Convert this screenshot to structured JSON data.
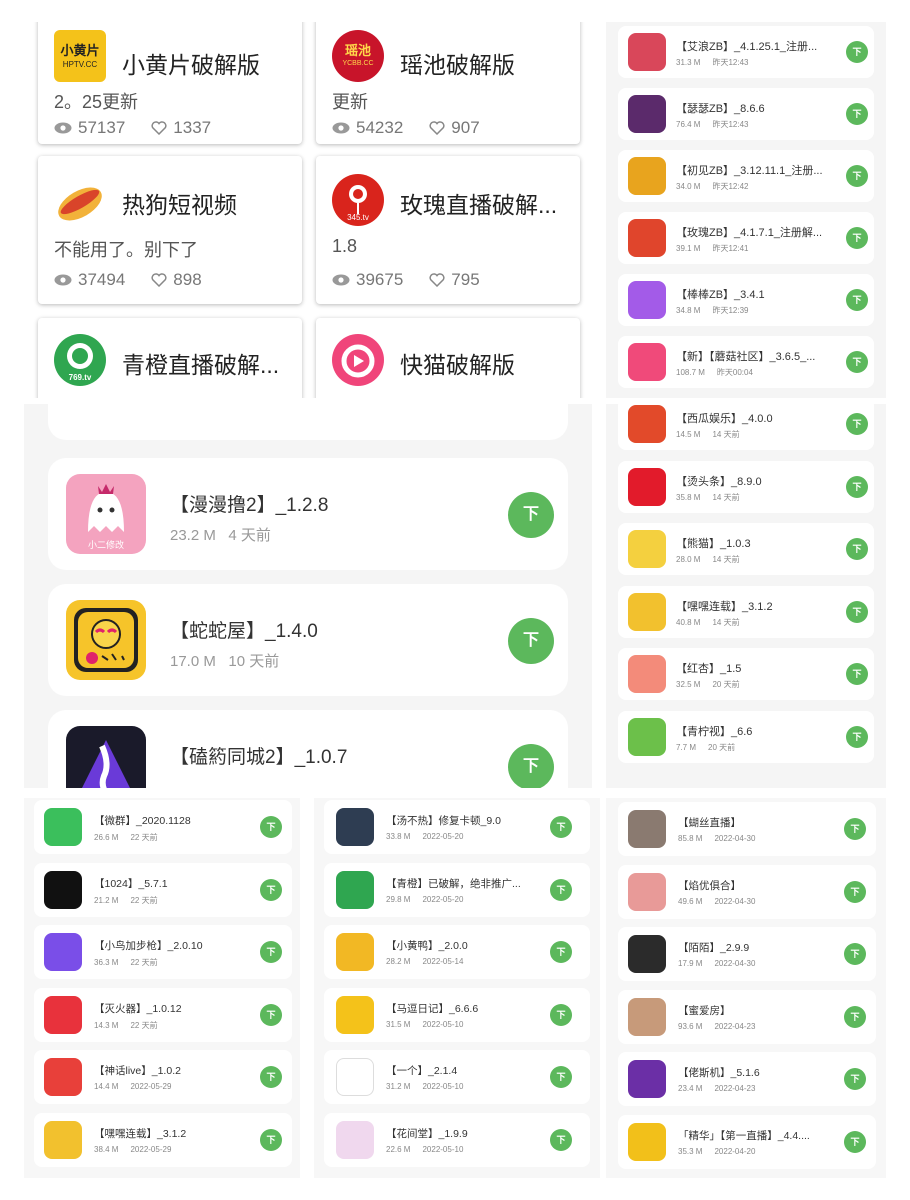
{
  "grid_cards": [
    {
      "name": "小黄片破解版",
      "desc": "2。25更新",
      "views": "57137",
      "likes": "1337",
      "icon": "xiaohuangpian-logo-icon"
    },
    {
      "name": "瑶池破解版",
      "desc": "更新",
      "views": "54232",
      "likes": "907",
      "icon": "yaochi-logo-icon"
    },
    {
      "name": "热狗短视频",
      "desc": "不能用了。别下了",
      "views": "37494",
      "likes": "898",
      "icon": "hotdog-icon"
    },
    {
      "name": "玫瑰直播破解...",
      "desc": "1.8",
      "views": "39675",
      "likes": "795",
      "icon": "rose-logo-icon"
    },
    {
      "name": "青橙直播破解...",
      "desc": "",
      "views": "",
      "likes": "",
      "icon": "qingcheng-logo-icon"
    },
    {
      "name": "快猫破解版",
      "desc": "",
      "views": "",
      "likes": "",
      "icon": "kuaimao-logo-icon"
    }
  ],
  "icon_badges": {
    "xiaohuangpian": "小黄片",
    "xiaohuangpian_sub": "HPTV.CC",
    "yaochi": "瑶池",
    "yaochi_sub": "YCBB.CC",
    "rose_sub": "345.tv",
    "qingcheng_sub": "769.tv"
  },
  "download_label": "下",
  "list_top_right": [
    {
      "name": "【艾浪ZB】_4.1.25.1_注册...",
      "size": "31.3 M",
      "time": "昨天12:43",
      "color": "#d9475a"
    },
    {
      "name": "【瑟瑟ZB】_8.6.6",
      "size": "76.4 M",
      "time": "昨天12:43",
      "color": "#5b2a6b"
    },
    {
      "name": "【初见ZB】_3.12.11.1_注册...",
      "size": "34.0 M",
      "time": "昨天12:42",
      "color": "#e8a41e"
    },
    {
      "name": "【玫瑰ZB】_4.1.7.1_注册解...",
      "size": "39.1 M",
      "time": "昨天12:41",
      "color": "#e0452c"
    },
    {
      "name": "【棒棒ZB】_3.4.1",
      "size": "34.8 M",
      "time": "昨天12:39",
      "color": "#a35be8"
    },
    {
      "name": "【新】【蘑菇社区】_3.6.5_...",
      "size": "108.7 M",
      "time": "昨天00:04",
      "color": "#f04a7a"
    }
  ],
  "list_middle": [
    {
      "name": "【漫漫撸2】_1.2.8",
      "size": "23.2 M",
      "time": "4 天前",
      "color": "#f4a3bf",
      "badge": "小二修改"
    },
    {
      "name": "【蛇蛇屋】_1.4.0",
      "size": "17.0 M",
      "time": "10 天前",
      "color": "#f6c42a",
      "badge": ""
    },
    {
      "name": "【磕箹同城2】_1.0.7",
      "size": "",
      "time": "",
      "color": "#1a1a2a",
      "badge": ""
    }
  ],
  "list_mid_right": [
    {
      "name": "【西瓜娱乐】_4.0.0",
      "size": "14.5 M",
      "time": "14 天前",
      "color": "#e24a2a"
    },
    {
      "name": "【烫头条】_8.9.0",
      "size": "35.8 M",
      "time": "14 天前",
      "color": "#e21b2b"
    },
    {
      "name": "【熊猫】_1.0.3",
      "size": "28.0 M",
      "time": "14 天前",
      "color": "#f4d03f"
    },
    {
      "name": "【嘿嘿连载】_3.1.2",
      "size": "40.8 M",
      "time": "14 天前",
      "color": "#f2c12e"
    },
    {
      "name": "【红杏】_1.5",
      "size": "32.5 M",
      "time": "20 天前",
      "color": "#f38b7a"
    },
    {
      "name": "【青柠视】_6.6",
      "size": "7.7 M",
      "time": "20 天前",
      "color": "#6cc04a"
    }
  ],
  "list_bottom_left": [
    {
      "name": "【微群】_2020.1128",
      "size": "26.6 M",
      "time": "22 天前",
      "color": "#3bbf5c"
    },
    {
      "name": "【1024】_5.7.1",
      "size": "21.2 M",
      "time": "22 天前",
      "color": "#111111"
    },
    {
      "name": "【小鸟加步枪】_2.0.10",
      "size": "36.3 M",
      "time": "22 天前",
      "color": "#7a4ee8"
    },
    {
      "name": "【灭火器】_1.0.12",
      "size": "14.3 M",
      "time": "22 天前",
      "color": "#e8323c"
    },
    {
      "name": "【神话live】_1.0.2",
      "size": "14.4 M",
      "time": "2022-05-29",
      "color": "#e8403a"
    },
    {
      "name": "【嘿嘿连载】_3.1.2",
      "size": "38.4 M",
      "time": "2022-05-29",
      "color": "#f2c12e"
    }
  ],
  "list_bottom_mid": [
    {
      "name": "【汤不热】修复卡顿_9.0",
      "size": "33.8 M",
      "time": "2022-05-20",
      "color": "#2e3d52"
    },
    {
      "name": "【青橙】已破解，绝非推广...",
      "size": "29.8 M",
      "time": "2022-05-20",
      "color": "#2fa650"
    },
    {
      "name": "【小黄鸭】_2.0.0",
      "size": "28.2 M",
      "time": "2022-05-14",
      "color": "#f2b824"
    },
    {
      "name": "【马逗日记】_6.6.6",
      "size": "31.5 M",
      "time": "2022-05-10",
      "color": "#f4c21a"
    },
    {
      "name": "【一个】_2.1.4",
      "size": "31.2 M",
      "time": "2022-05-10",
      "color": "#ffffff"
    },
    {
      "name": "【花间堂】_1.9.9",
      "size": "22.6 M",
      "time": "2022-05-10",
      "color": "#f0d8ee"
    }
  ],
  "list_bottom_right": [
    {
      "name": "【蝴丝直播】",
      "size": "85.8 M",
      "time": "2022-04-30",
      "color": "#8a7a70"
    },
    {
      "name": "【焰优俱合】",
      "size": "49.6 M",
      "time": "2022-04-30",
      "color": "#e89a98"
    },
    {
      "name": "【陌陌】_2.9.9",
      "size": "17.9 M",
      "time": "2022-04-30",
      "color": "#2b2b2b"
    },
    {
      "name": "【蜜爱房】",
      "size": "93.6 M",
      "time": "2022-04-23",
      "color": "#c79a7a"
    },
    {
      "name": "【佬斯机】_5.1.6",
      "size": "23.4 M",
      "time": "2022-04-23",
      "color": "#6b2fa6"
    },
    {
      "name": "「精华」【第一直播】_4.4....",
      "size": "35.3 M",
      "time": "2022-04-20",
      "color": "#f2c01a"
    }
  ],
  "colors": {
    "download_green": "#5cb85c",
    "card_bg": "#ffffff",
    "panel_bg": "#f5f5f5"
  }
}
